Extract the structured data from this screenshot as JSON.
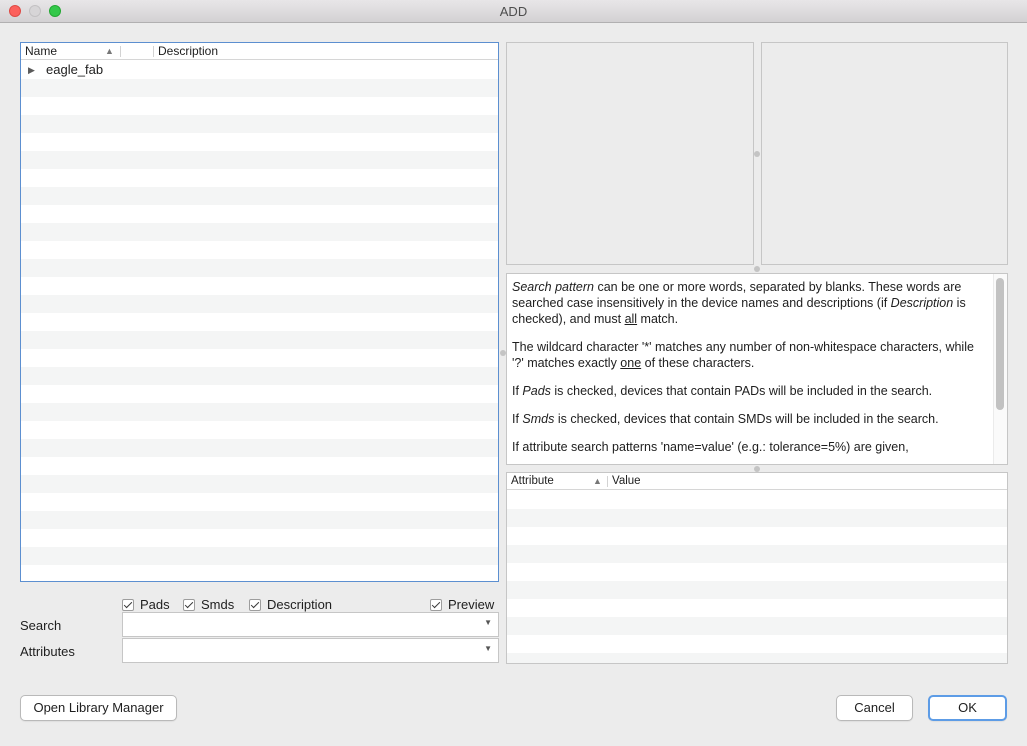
{
  "window": {
    "title": "ADD"
  },
  "tree": {
    "columns": {
      "name": "Name",
      "description": "Description"
    },
    "rows": [
      {
        "name": "eagle_fab",
        "description": ""
      }
    ]
  },
  "help": {
    "p1": {
      "italic": "Search pattern",
      "t1": " can be one or more words, separated by blanks. These words are searched case insensitively in the device names and descriptions (if ",
      "italic2": "Description",
      "t2": " is checked), and must ",
      "underline": "all",
      "t3": " match."
    },
    "p2": {
      "t1": "The wildcard character '*' matches any number of non-whitespace characters, while '?' matches exactly ",
      "underline": "one",
      "t2": " of these characters."
    },
    "p3": {
      "t1": "If ",
      "italic": "Pads",
      "t2": " is checked, devices that contain PADs will be included in the search."
    },
    "p4": {
      "t1": "If ",
      "italic": "Smds",
      "t2": " is checked, devices that contain SMDs will be included in the search."
    },
    "p5": {
      "t1": "If attribute search patterns 'name=value' (e.g.: tolerance=5%) are given,"
    }
  },
  "attributes": {
    "columns": {
      "attribute": "Attribute",
      "value": "Value"
    }
  },
  "checkboxes": {
    "pads": "Pads",
    "smds": "Smds",
    "description": "Description",
    "preview": "Preview"
  },
  "search": {
    "label": "Search",
    "value": ""
  },
  "attr_search": {
    "label": "Attributes",
    "value": ""
  },
  "buttons": {
    "open_library_manager": "Open Library Manager",
    "cancel": "Cancel",
    "ok": "OK"
  }
}
